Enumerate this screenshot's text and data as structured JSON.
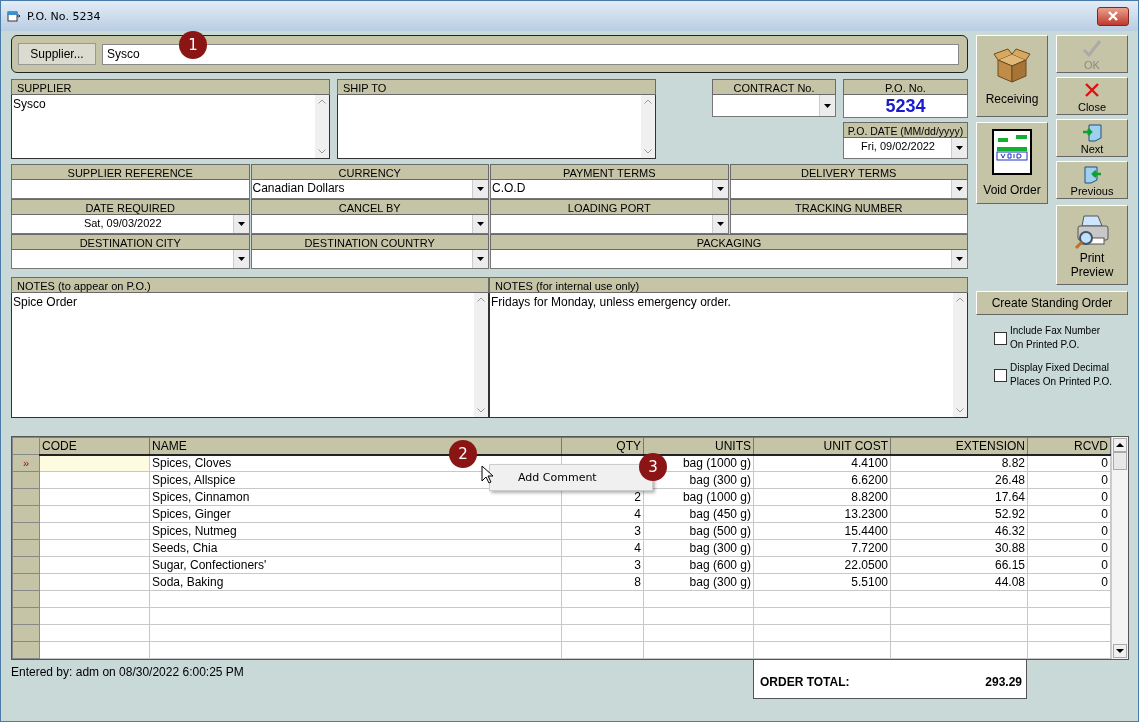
{
  "window": {
    "title": "P.O. No. 5234"
  },
  "supplier_bar": {
    "button": "Supplier...",
    "value": "Sysco"
  },
  "address_boxes": [
    {
      "label": "SUPPLIER",
      "value": "Sysco"
    },
    {
      "label": "SHIP TO"
    }
  ],
  "contract": {
    "label": "CONTRACT No."
  },
  "po_number": {
    "label": "P.O. No.",
    "value": "5234"
  },
  "po_date": {
    "label": "P.O. DATE (MM/dd/yyyy)",
    "value": "Fri, 09/02/2022"
  },
  "fields": [
    {
      "label": "SUPPLIER REFERENCE",
      "kind": "text"
    },
    {
      "label": "CURRENCY",
      "kind": "dropdown",
      "value": "Canadian Dollars"
    },
    {
      "label": "PAYMENT TERMS",
      "kind": "dropdown",
      "value": "C.O.D"
    },
    {
      "label": "DELIVERY TERMS",
      "kind": "dropdown"
    },
    {
      "label": "DATE REQUIRED",
      "kind": "date",
      "value": "Sat, 09/03/2022"
    },
    {
      "label": "CANCEL BY",
      "kind": "dropdown"
    },
    {
      "label": "LOADING PORT",
      "kind": "dropdown"
    },
    {
      "label": "TRACKING NUMBER",
      "kind": "text"
    },
    {
      "label": "DESTINATION CITY",
      "kind": "dropdown"
    },
    {
      "label": "DESTINATION COUNTRY",
      "kind": "dropdown"
    },
    {
      "label": "PACKAGING",
      "kind": "dropdown",
      "wide": true
    }
  ],
  "notes": [
    {
      "label": "NOTES (to appear on P.O.)",
      "value": "Spice Order"
    },
    {
      "label": "NOTES (for internal use only)",
      "value": "Fridays for Monday, unless emergency order."
    }
  ],
  "large_buttons": [
    {
      "label": "Receiving",
      "kind": "box"
    },
    {
      "label": "Void Order",
      "kind": "void"
    }
  ],
  "nav_buttons": [
    {
      "label": "OK",
      "kind": "check",
      "disabled": true
    },
    {
      "label": "Close",
      "kind": "cross",
      "disabled": false
    },
    {
      "label": "Next",
      "kind": "next",
      "disabled": false
    },
    {
      "label": "Previous",
      "kind": "previous",
      "disabled": false
    },
    {
      "label": "Print Preview",
      "kind": "printer",
      "disabled": false
    }
  ],
  "standing_order_button": "Create Standing Order",
  "options": [
    {
      "label": "Include Fax Number On Printed P.O.",
      "checked": false
    },
    {
      "label": "Display Fixed Decimal Places On Printed P.O.",
      "checked": false
    }
  ],
  "grid": {
    "row_marker": "»",
    "columns": [
      "CODE",
      "NAME",
      "QTY",
      "UNITS",
      "UNIT COST",
      "EXTENSION",
      "RCVD"
    ],
    "rows": [
      {
        "selected": true,
        "cells": [
          null,
          "Spices, Cloves",
          null,
          "bag (1000 g)",
          "4.4100",
          "8.82",
          "0"
        ]
      },
      {
        "selected": false,
        "cells": [
          null,
          "Spices, Allspice",
          null,
          "bag (300 g)",
          "6.6200",
          "26.48",
          "0"
        ]
      },
      {
        "selected": false,
        "cells": [
          null,
          "Spices, Cinnamon",
          "2",
          "bag (1000 g)",
          "8.8200",
          "17.64",
          "0"
        ]
      },
      {
        "selected": false,
        "cells": [
          null,
          "Spices, Ginger",
          "4",
          "bag (450 g)",
          "13.2300",
          "52.92",
          "0"
        ]
      },
      {
        "selected": false,
        "cells": [
          null,
          "Spices, Nutmeg",
          "3",
          "bag (500 g)",
          "15.4400",
          "46.32",
          "0"
        ]
      },
      {
        "selected": false,
        "cells": [
          null,
          "Seeds, Chia",
          "4",
          "bag (300 g)",
          "7.7200",
          "30.88",
          "0"
        ]
      },
      {
        "selected": false,
        "cells": [
          null,
          "Sugar, Confectioners'",
          "3",
          "bag (600 g)",
          "22.0500",
          "66.15",
          "0"
        ]
      },
      {
        "selected": false,
        "cells": [
          null,
          "Soda, Baking",
          "8",
          "bag (300 g)",
          "5.5100",
          "44.08",
          "0"
        ]
      }
    ]
  },
  "footer": {
    "entered_by": "Entered by: adm on 08/30/2022 6:00:25 PM",
    "total_label": "ORDER TOTAL:",
    "total": "293.29"
  },
  "context_menu": {
    "items": [
      "Add Comment"
    ]
  },
  "callouts": [
    "1",
    "2",
    "3"
  ]
}
